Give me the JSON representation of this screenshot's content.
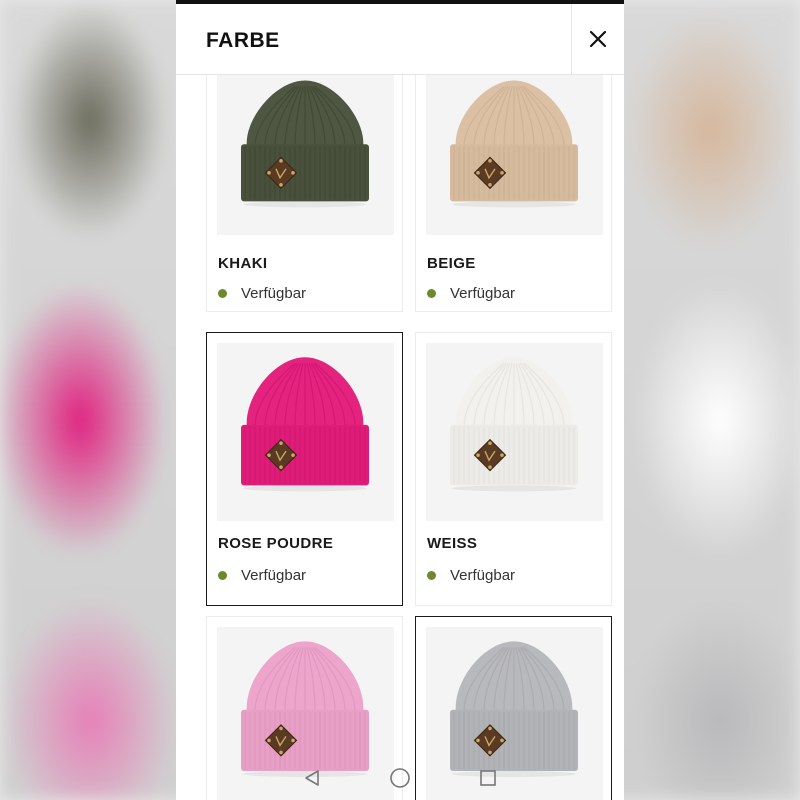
{
  "header": {
    "title": "FARBE",
    "close_icon": "close-icon"
  },
  "status_color": "#6a8a2b",
  "colors": [
    {
      "name": "KHAKI",
      "status": "Verfügbar",
      "hat_color": "#4f5642",
      "selected": false
    },
    {
      "name": "BEIGE",
      "status": "Verfügbar",
      "hat_color": "#dcc0a4",
      "selected": false
    },
    {
      "name": "ROSE POUDRE",
      "status": "Verfügbar",
      "hat_color": "#e4237f",
      "selected": true
    },
    {
      "name": "WEISS",
      "status": "Verfügbar",
      "hat_color": "#f2f1ee",
      "selected": false
    },
    {
      "name": "",
      "status": "",
      "hat_color": "#eea5cc",
      "selected": false
    },
    {
      "name": "",
      "status": "",
      "hat_color": "#b8b9bc",
      "selected": true
    }
  ],
  "system_nav": {
    "back": "back-triangle-icon",
    "home": "home-circle-icon",
    "recent": "recent-square-icon"
  }
}
